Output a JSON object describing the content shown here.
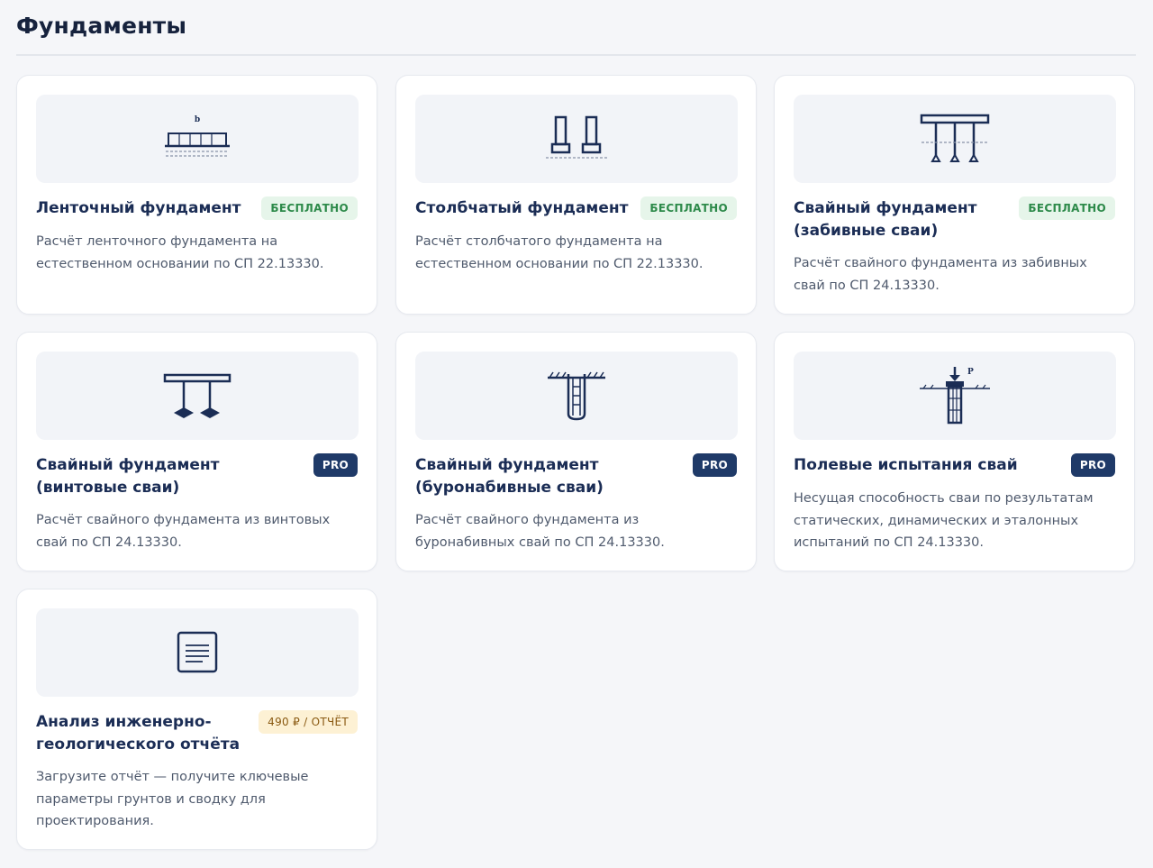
{
  "page": {
    "title": "Фундаменты"
  },
  "colors": {
    "navy": "#1b2d55",
    "free_badge_bg": "#e6f5ea",
    "free_badge_text": "#2d8a4a",
    "pro_badge_bg": "#1f3a68",
    "paid_badge_bg": "#fdf1d4"
  },
  "cards": [
    {
      "title": "Ленточный фундамент",
      "badge": "БЕСПЛАТНО",
      "badge_type": "free",
      "icon": "strip-foundation-icon",
      "icon_label": "b",
      "description": "Расчёт ленточного фундамента на естественном основании по СП 22.13330."
    },
    {
      "title": "Столбчатый фундамент",
      "badge": "БЕСПЛАТНО",
      "badge_type": "free",
      "icon": "column-foundation-icon",
      "description": "Расчёт столбчатого фундамента на естественном основании по СП 22.13330."
    },
    {
      "title": "Свайный фундамент (забивные сваи)",
      "badge": "БЕСПЛАТНО",
      "badge_type": "free",
      "icon": "driven-piles-icon",
      "description": "Расчёт свайного фундамента из забивных свай по СП 24.13330."
    },
    {
      "title": "Свайный фундамент (винтовые сваи)",
      "badge": "PRO",
      "badge_type": "pro",
      "icon": "screw-piles-icon",
      "description": "Расчёт свайного фундамента из винтовых свай по СП 24.13330."
    },
    {
      "title": "Свайный фундамент (буронабивные сваи)",
      "badge": "PRO",
      "badge_type": "pro",
      "icon": "bored-piles-icon",
      "description": "Расчёт свайного фундамента из буронабивных свай по СП 24.13330."
    },
    {
      "title": "Полевые испытания свай",
      "badge": "PRO",
      "badge_type": "pro",
      "icon": "pile-testing-icon",
      "icon_label": "P",
      "description": "Несущая способность сваи по результатам статических, динамических и эталонных испытаний по СП 24.13330."
    },
    {
      "title": "Анализ инженерно-геологического отчёта",
      "badge": "490 ₽ / ОТЧЁТ",
      "badge_type": "paid",
      "icon": "document-icon",
      "description": "Загрузите отчёт — получите ключевые параметры грунтов и сводку для проектирования."
    }
  ]
}
